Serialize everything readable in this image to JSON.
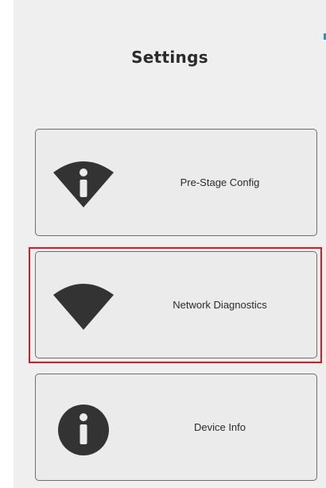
{
  "header": {
    "title": "Settings"
  },
  "menu": {
    "items": [
      {
        "label": "Pre-Stage Config",
        "icon": "wifi-info-icon"
      },
      {
        "label": "Network Diagnostics",
        "icon": "wifi-icon",
        "highlighted": true
      },
      {
        "label": "Device Info",
        "icon": "info-icon"
      }
    ]
  },
  "colors": {
    "background": "#efefef",
    "icon": "#333333",
    "text": "#2b2b2b",
    "highlight_border": "#e0191f",
    "button_border": "#6e6e6e"
  }
}
